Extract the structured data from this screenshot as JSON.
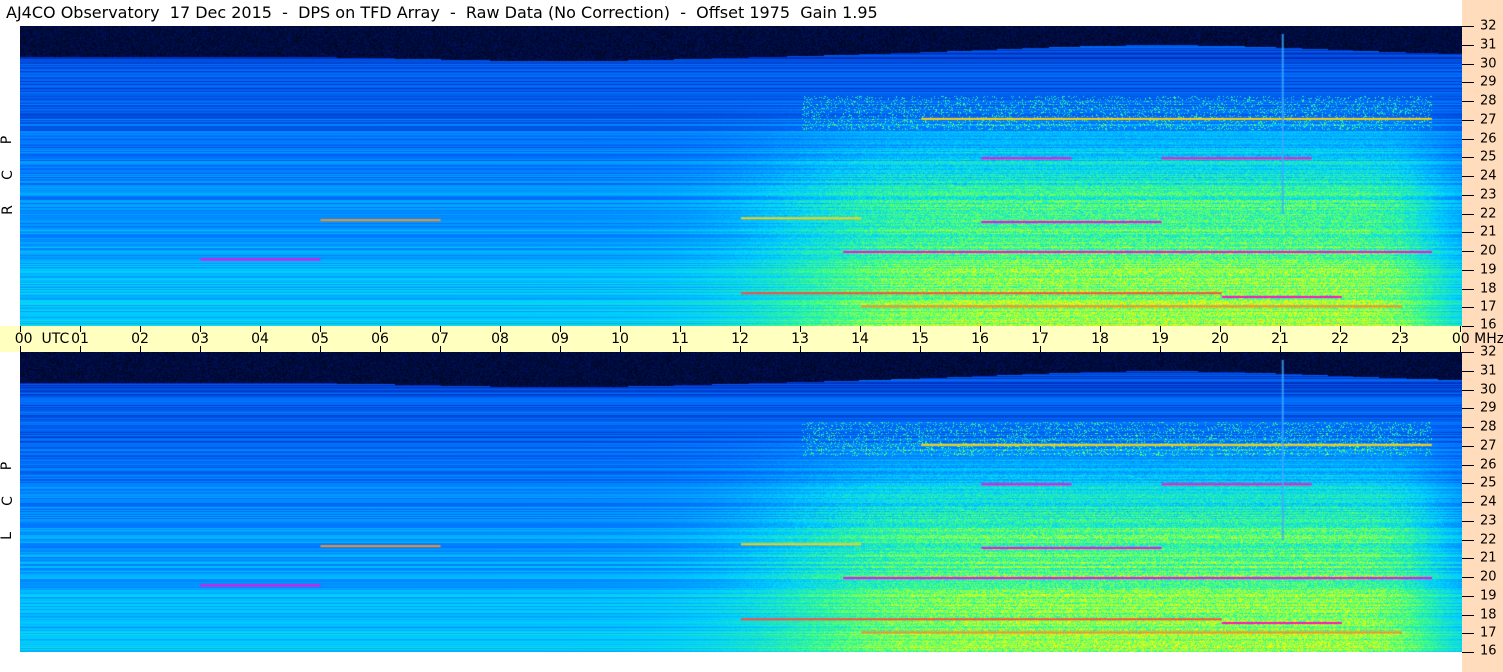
{
  "title": "AJ4CO Observatory  17 Dec 2015  -  DPS on TFD Array  -  Raw Data (No Correction)  -  Offset 1975  Gain 1.95",
  "chart_data": {
    "type": "heatmap",
    "title": "AJ4CO Observatory  17 Dec 2015  -  DPS on TFD Array  -  Raw Data (No Correction)  -  Offset 1975  Gain 1.95",
    "xlabel": "UTC",
    "ylabel": "MHz",
    "xlim": [
      0,
      24
    ],
    "ylim": [
      16,
      32
    ],
    "x_ticks": [
      "00",
      "01",
      "02",
      "03",
      "04",
      "05",
      "06",
      "07",
      "08",
      "09",
      "10",
      "11",
      "12",
      "13",
      "14",
      "15",
      "16",
      "17",
      "18",
      "19",
      "20",
      "21",
      "22",
      "23",
      "00"
    ],
    "y_ticks": [
      "16",
      "17",
      "18",
      "19",
      "20",
      "21",
      "22",
      "23",
      "24",
      "25",
      "26",
      "27",
      "28",
      "29",
      "30",
      "31",
      "32"
    ],
    "panels": [
      {
        "name": "RCP",
        "letters": [
          "R",
          "C",
          "P"
        ]
      },
      {
        "name": "LCP",
        "letters": [
          "L",
          "C",
          "P"
        ]
      }
    ],
    "first_x_unit": "UTC",
    "last_y_unit": "MHz",
    "colormap": [
      "#000000",
      "#0020b0",
      "#0070ff",
      "#00d0ff",
      "#40ff80",
      "#ffff00",
      "#ff4040",
      "#ff00ff"
    ]
  }
}
